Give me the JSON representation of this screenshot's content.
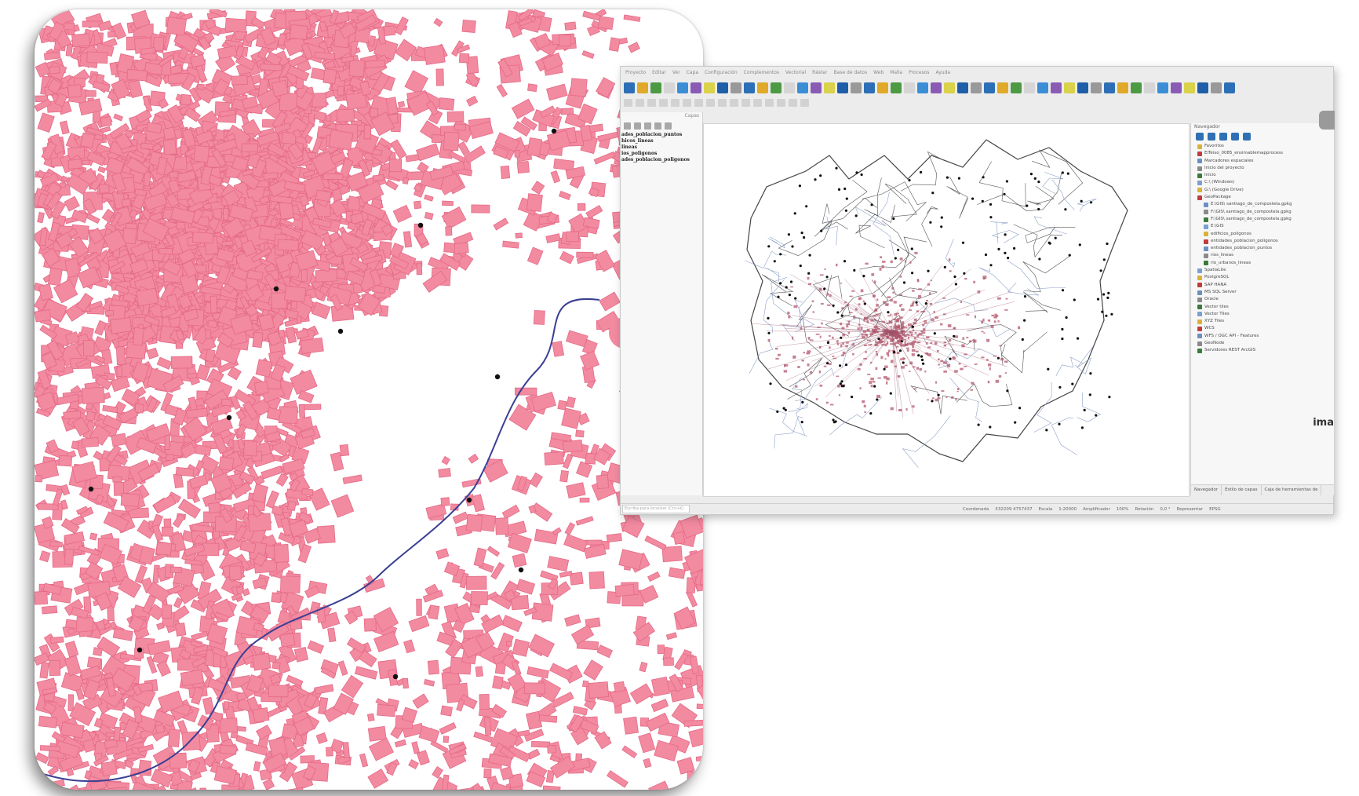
{
  "qgis": {
    "menu": [
      "Proyecto",
      "Editar",
      "Ver",
      "Capa",
      "Configuración",
      "Complementos",
      "Vectorial",
      "Ráster",
      "Base de datos",
      "Web",
      "Malla",
      "Procesos",
      "Ayuda"
    ],
    "layers_panel": {
      "title": "Capas",
      "items": [
        "ades_poblacion_puntos",
        "hicos_lineas",
        "lineas",
        "ios_poligonos",
        "ades_poblacion_poligonos"
      ]
    },
    "browser_panel": {
      "title": "Navegador",
      "items": [
        "Favoritos",
        "ElTeixo_0085_ensimablemapprocess",
        "Marcadores espaciales",
        "Inicio del proyecto",
        "Inicio",
        "C:\\ (Windows)",
        "G:\\ (Google Drive)",
        "GeoPackage",
        "E:\\GIS\\ santiago_de_compostela.gpkg",
        "F:\\GIS\\ santiago_de_compostela.gpkg",
        "F:\\GIS\\ santiago_de_compostela.gpkg",
        "E:\\GIS",
        "edificios_poligonos",
        "entidades_poblacion_poligonos",
        "entidades_poblacion_puntos",
        "rios_lineas",
        "rio_urbanos_lineas",
        "SpatiaLite",
        "PostgreSQL",
        "SAP HANA",
        "MS SQL Server",
        "Oracle",
        "Vector tiles",
        "Vector Tiles",
        "XYZ Tiles",
        "WCS",
        "WFS / OGC API - Features",
        "GeoNode",
        "Servidores REST ArcGIS"
      ],
      "tabs": [
        "Navegador",
        "Estilo de capas",
        "Caja de herramientas de"
      ]
    },
    "statusbar": {
      "locator_placeholder": "Escriba para localizar (Ctrl+K)",
      "coordinate_label": "Coordenada",
      "coordinate_value": "532209 4757437",
      "scale_label": "Escala",
      "scale_value": "1:20000",
      "magnifier_label": "Amplificador",
      "magnifier_value": "100%",
      "rotation_label": "Rotación",
      "rotation_value": "0,0 °",
      "render_label": "Representar",
      "crs": "EPSG"
    },
    "watermark": "ima"
  },
  "colors": {
    "building_fill": "#f28aa0",
    "building_stroke": "#e46a86",
    "river": "#3b3f93",
    "boundary": "#444444",
    "point": "#111111"
  }
}
